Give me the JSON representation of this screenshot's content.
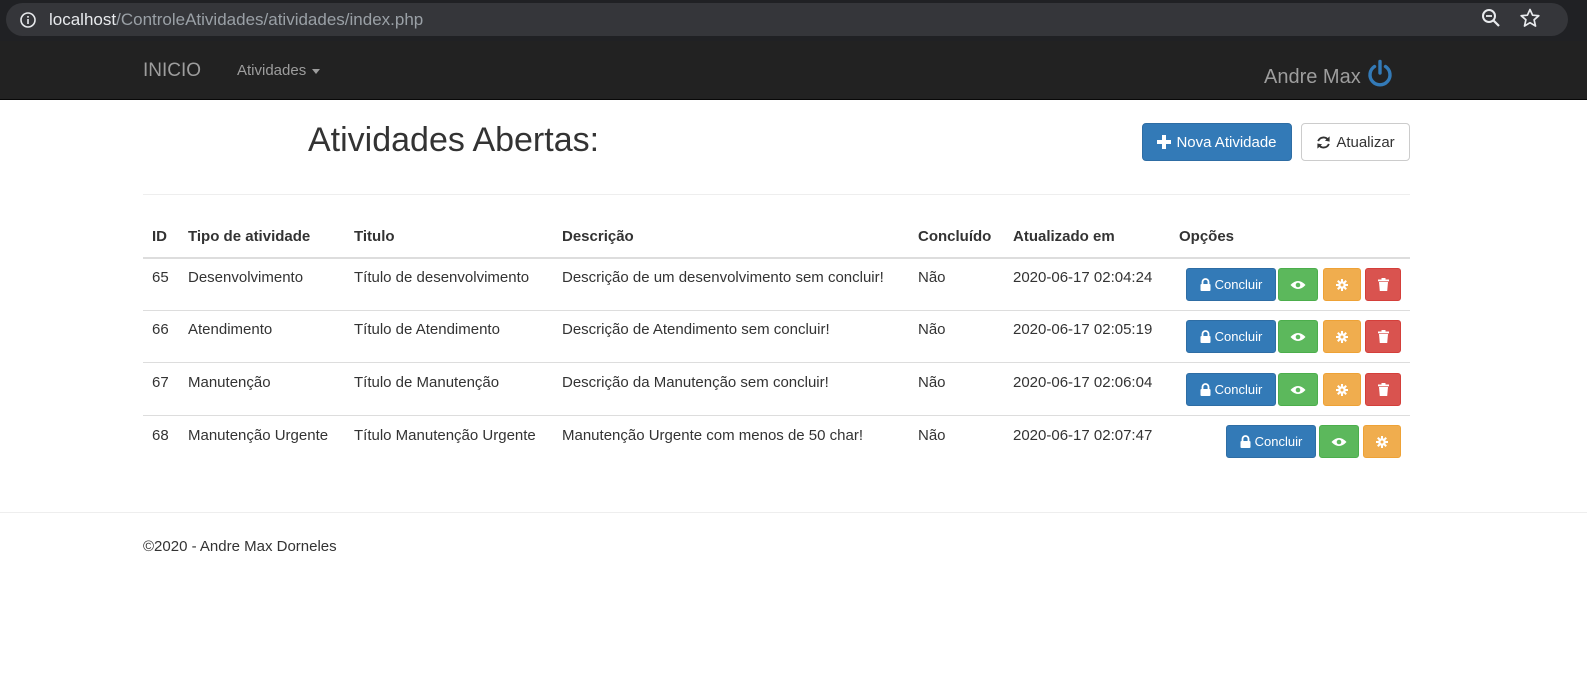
{
  "browser": {
    "url_host": "localhost",
    "url_path": "/ControleAtividades/atividades/index.php",
    "icons": [
      "info-icon",
      "zoom-icon",
      "star-icon"
    ]
  },
  "navbar": {
    "brand": "INICIO",
    "menu_atividades": "Atividades",
    "user_name": "Andre Max",
    "power_icon": "power-icon",
    "power_color": "#337ab7"
  },
  "header": {
    "title": "Atividades Abertas:",
    "nova_label": "Nova Atividade",
    "atualizar_label": "Atualizar"
  },
  "table": {
    "columns": [
      "ID",
      "Tipo de atividade",
      "Titulo",
      "Descrição",
      "Concluído",
      "Atualizado em",
      "Opções"
    ],
    "rows": [
      {
        "id": "65",
        "tipo": "Desenvolvimento",
        "titulo": "Título de desenvolvimento",
        "descricao": "Descrição de um desenvolvimento sem concluir!",
        "concluido": "Não",
        "atualizado": "2020-06-17 02:04:24",
        "has_delete": true
      },
      {
        "id": "66",
        "tipo": "Atendimento",
        "titulo": "Título de Atendimento",
        "descricao": "Descrição de Atendimento sem concluir!",
        "concluido": "Não",
        "atualizado": "2020-06-17 02:05:19",
        "has_delete": true
      },
      {
        "id": "67",
        "tipo": "Manutenção",
        "titulo": "Título de Manutenção",
        "descricao": "Descrição da Manutenção sem concluir!",
        "concluido": "Não",
        "atualizado": "2020-06-17 02:06:04",
        "has_delete": true
      },
      {
        "id": "68",
        "tipo": "Manutenção Urgente",
        "titulo": "Título Manutenção Urgente",
        "descricao": "Manutenção Urgente com menos de 50 char!",
        "concluido": "Não",
        "atualizado": "2020-06-17 02:07:47",
        "has_delete": false
      }
    ],
    "concluir_label": "Concluir"
  },
  "colors": {
    "primary": "#337ab7",
    "success": "#5cb85c",
    "warning": "#f0ad4e",
    "danger": "#d9534f",
    "navbar": "#222222"
  },
  "footer": {
    "text": "©2020 - Andre Max Dorneles"
  }
}
